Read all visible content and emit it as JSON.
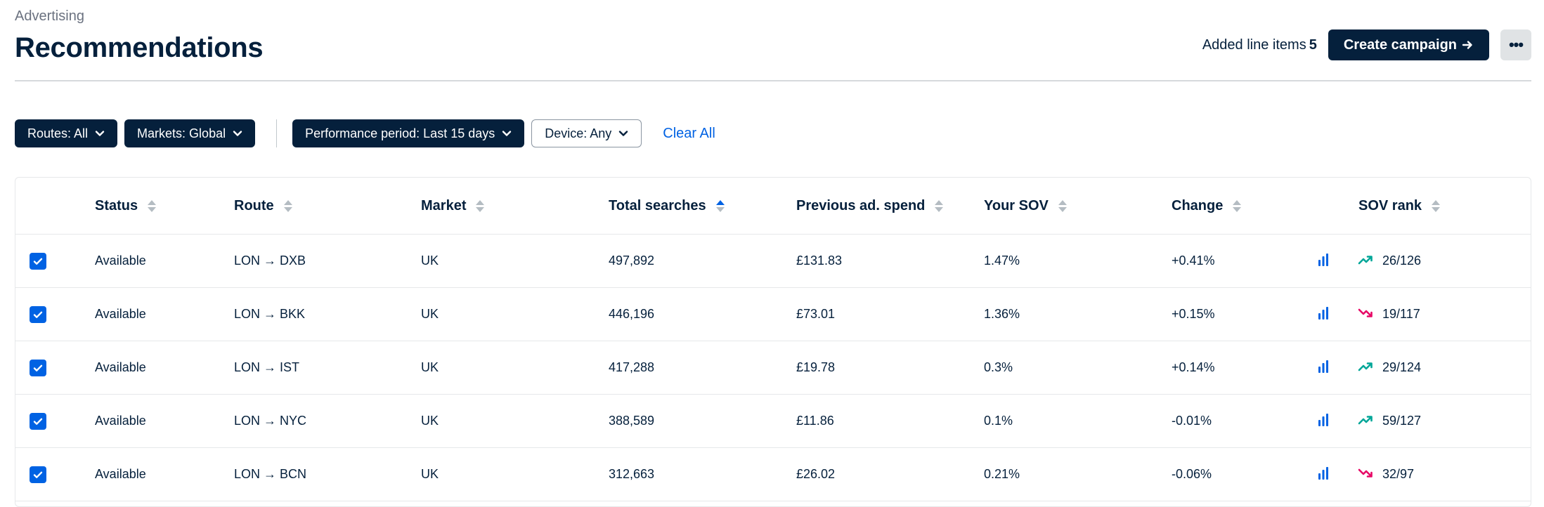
{
  "header": {
    "breadcrumb": "Advertising",
    "title": "Recommendations",
    "added_label": "Added line items",
    "added_count": "5",
    "create_label": "Create campaign",
    "more_label": "•••"
  },
  "filters": {
    "routes": "Routes: All",
    "markets": "Markets: Global",
    "period": "Performance period: Last 15 days",
    "device": "Device: Any",
    "clear": "Clear All"
  },
  "table": {
    "columns": {
      "status": "Status",
      "route": "Route",
      "market": "Market",
      "searches": "Total searches",
      "spend": "Previous ad. spend",
      "sov": "Your SOV",
      "change": "Change",
      "rank": "SOV rank"
    },
    "active_sort": "searches",
    "rows": [
      {
        "status": "Available",
        "route": "LON → DXB",
        "market": "UK",
        "searches": "497,892",
        "spend": "£131.83",
        "sov": "1.47%",
        "change": "+0.41%",
        "trend": "up",
        "rank": "26/126",
        "checked": true
      },
      {
        "status": "Available",
        "route": "LON → BKK",
        "market": "UK",
        "searches": "446,196",
        "spend": "£73.01",
        "sov": "1.36%",
        "change": "+0.15%",
        "trend": "down",
        "rank": "19/117",
        "checked": true
      },
      {
        "status": "Available",
        "route": "LON → IST",
        "market": "UK",
        "searches": "417,288",
        "spend": "£19.78",
        "sov": "0.3%",
        "change": "+0.14%",
        "trend": "up",
        "rank": "29/124",
        "checked": true
      },
      {
        "status": "Available",
        "route": "LON → NYC",
        "market": "UK",
        "searches": "388,589",
        "spend": "£11.86",
        "sov": "0.1%",
        "change": "-0.01%",
        "trend": "up",
        "rank": "59/127",
        "checked": true
      },
      {
        "status": "Available",
        "route": "LON → BCN",
        "market": "UK",
        "searches": "312,663",
        "spend": "£26.02",
        "sov": "0.21%",
        "change": "-0.06%",
        "trend": "down",
        "rank": "32/97",
        "checked": true
      }
    ]
  },
  "colors": {
    "navy": "#05203c",
    "blue": "#0062e3",
    "trend_up": "#00a698",
    "trend_down": "#e70866"
  }
}
